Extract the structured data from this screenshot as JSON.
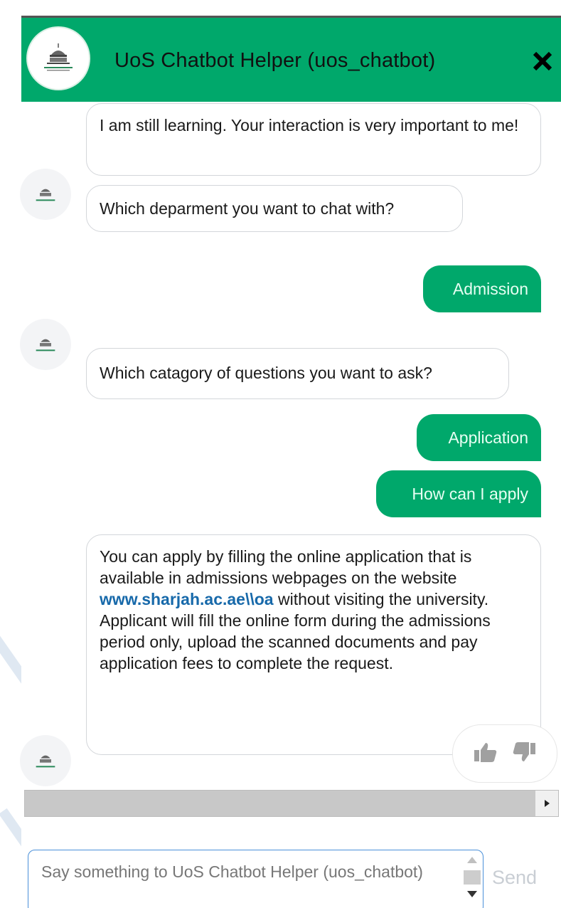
{
  "header": {
    "title": "UoS Chatbot Helper (uos_chatbot)",
    "close_icon": "close-icon",
    "avatar_icon": "university-logo-icon"
  },
  "colors": {
    "brand_green": "#00a86b",
    "user_text": "#e7fff3",
    "link_blue": "#1769aa"
  },
  "messages": [
    {
      "sender": "bot",
      "text": "I am still learning. Your interaction is very important to me!"
    },
    {
      "sender": "bot",
      "text": "Which deparment you want to chat with?"
    },
    {
      "sender": "user",
      "text": "Admission"
    },
    {
      "sender": "bot",
      "text": "Which catagory of questions you want to ask?"
    },
    {
      "sender": "user",
      "text": "Application"
    },
    {
      "sender": "user",
      "text": "How can I apply"
    },
    {
      "sender": "bot",
      "text_before_link": "You can apply by filling the online application that is available in admissions webpages on the website ",
      "link": "www.sharjah.ac.ae\\\\oa",
      "text_after_link": " without visiting the university.",
      "text_second_paragraph": "Applicant will fill the online form during the admissions period only, upload the scanned documents and pay application fees to complete the request."
    }
  ],
  "feedback": {
    "like_icon": "thumbs-up-icon",
    "dislike_icon": "thumbs-down-icon"
  },
  "composer": {
    "placeholder": "Say something to UoS Chatbot Helper (uos_chatbot)",
    "send_label": "Send"
  }
}
